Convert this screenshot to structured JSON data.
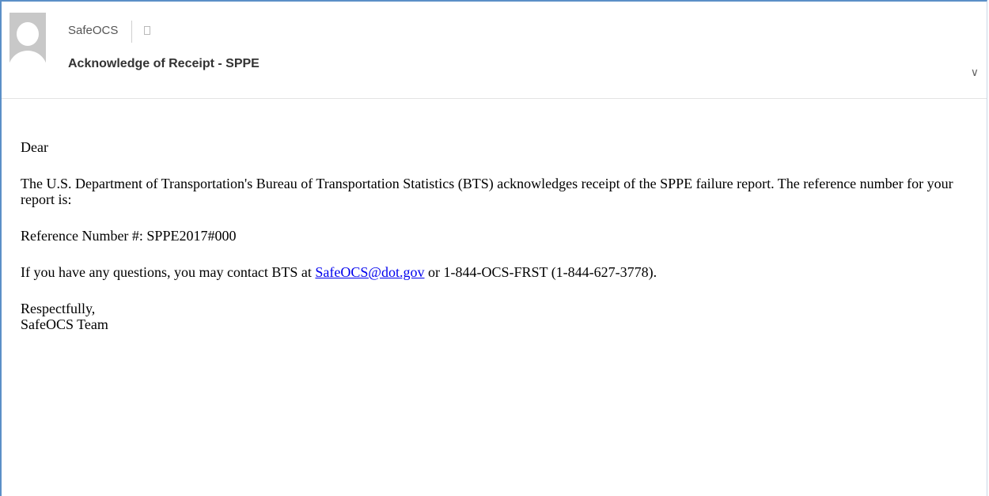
{
  "header": {
    "sender": "SafeOCS",
    "subject": "Acknowledge of Receipt - SPPE",
    "avatar": "contact-photo-placeholder",
    "expand_icon": "chevron-down-icon"
  },
  "email": {
    "greeting": "Dear",
    "intro": "The U.S. Department of Transportation's Bureau of Transportation Statistics (BTS) acknowledges receipt of the SPPE failure report. The reference number for your report is:",
    "reference": "Reference Number #: SPPE2017#000",
    "contact_prefix": "If you have any questions, you may contact BTS at ",
    "contact_email": "SafeOCS@dot.gov",
    "contact_suffix": " or 1-844-OCS-FRST (1-844-627-3778).",
    "closing": "Respectfully,",
    "signature": "SafeOCS Team"
  },
  "colors": {
    "frame_border": "#5b8fc7",
    "link": "#0000ee"
  }
}
